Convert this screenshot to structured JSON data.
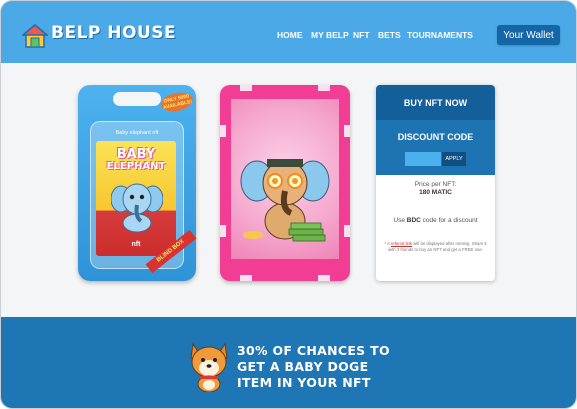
{
  "header": {
    "brand": "BELP HOUSE",
    "nav": [
      {
        "label": "HOME"
      },
      {
        "label": "MY BELP"
      },
      {
        "label": "NFT"
      },
      {
        "label": "BETS"
      },
      {
        "label": "TOURNAMENTS"
      }
    ],
    "wallet_label": "Your Wallet",
    "logo_icon": "house-logo-icon"
  },
  "products": {
    "blister": {
      "hot_badge": "ONLY 5000 AVAILABLE!",
      "pack_name": "Baby elephant nft",
      "title_line1": "BABY",
      "title_line2": "ELEPHANT",
      "nft_label": "nft",
      "ribbon": "BLIND BOX"
    },
    "pink_card": {
      "image": "elephant-nft-icon"
    }
  },
  "panel": {
    "buy_label": "BUY NFT NOW",
    "discount_title": "DISCOUNT CODE",
    "code_value": "",
    "code_placeholder": "",
    "apply_label": "APPLY",
    "price_label": "Price per NFT:",
    "price_value": "180 MATIC",
    "code_hint_prefix": "Use ",
    "code_hint_code": "BDC",
    "code_hint_suffix": " code for a discount",
    "ref_prefix": "* A ",
    "ref_link": "referral link",
    "ref_suffix": " will be displayed after minting. Share it with 3 friends to buy an NFT and get a FREE one."
  },
  "footer": {
    "promo_line1": "30% OF CHANCES TO",
    "promo_line2": "GET A BABY DOGE",
    "promo_line3": "ITEM IN YOUR NFT",
    "mascot": "shiba-doge-icon"
  },
  "colors": {
    "header_bg": "#4aa9e6",
    "footer_bg": "#1e76b4",
    "buy_bg": "#145f99",
    "discount_bg": "#1e74b3",
    "pink_card": "#f23d95"
  }
}
